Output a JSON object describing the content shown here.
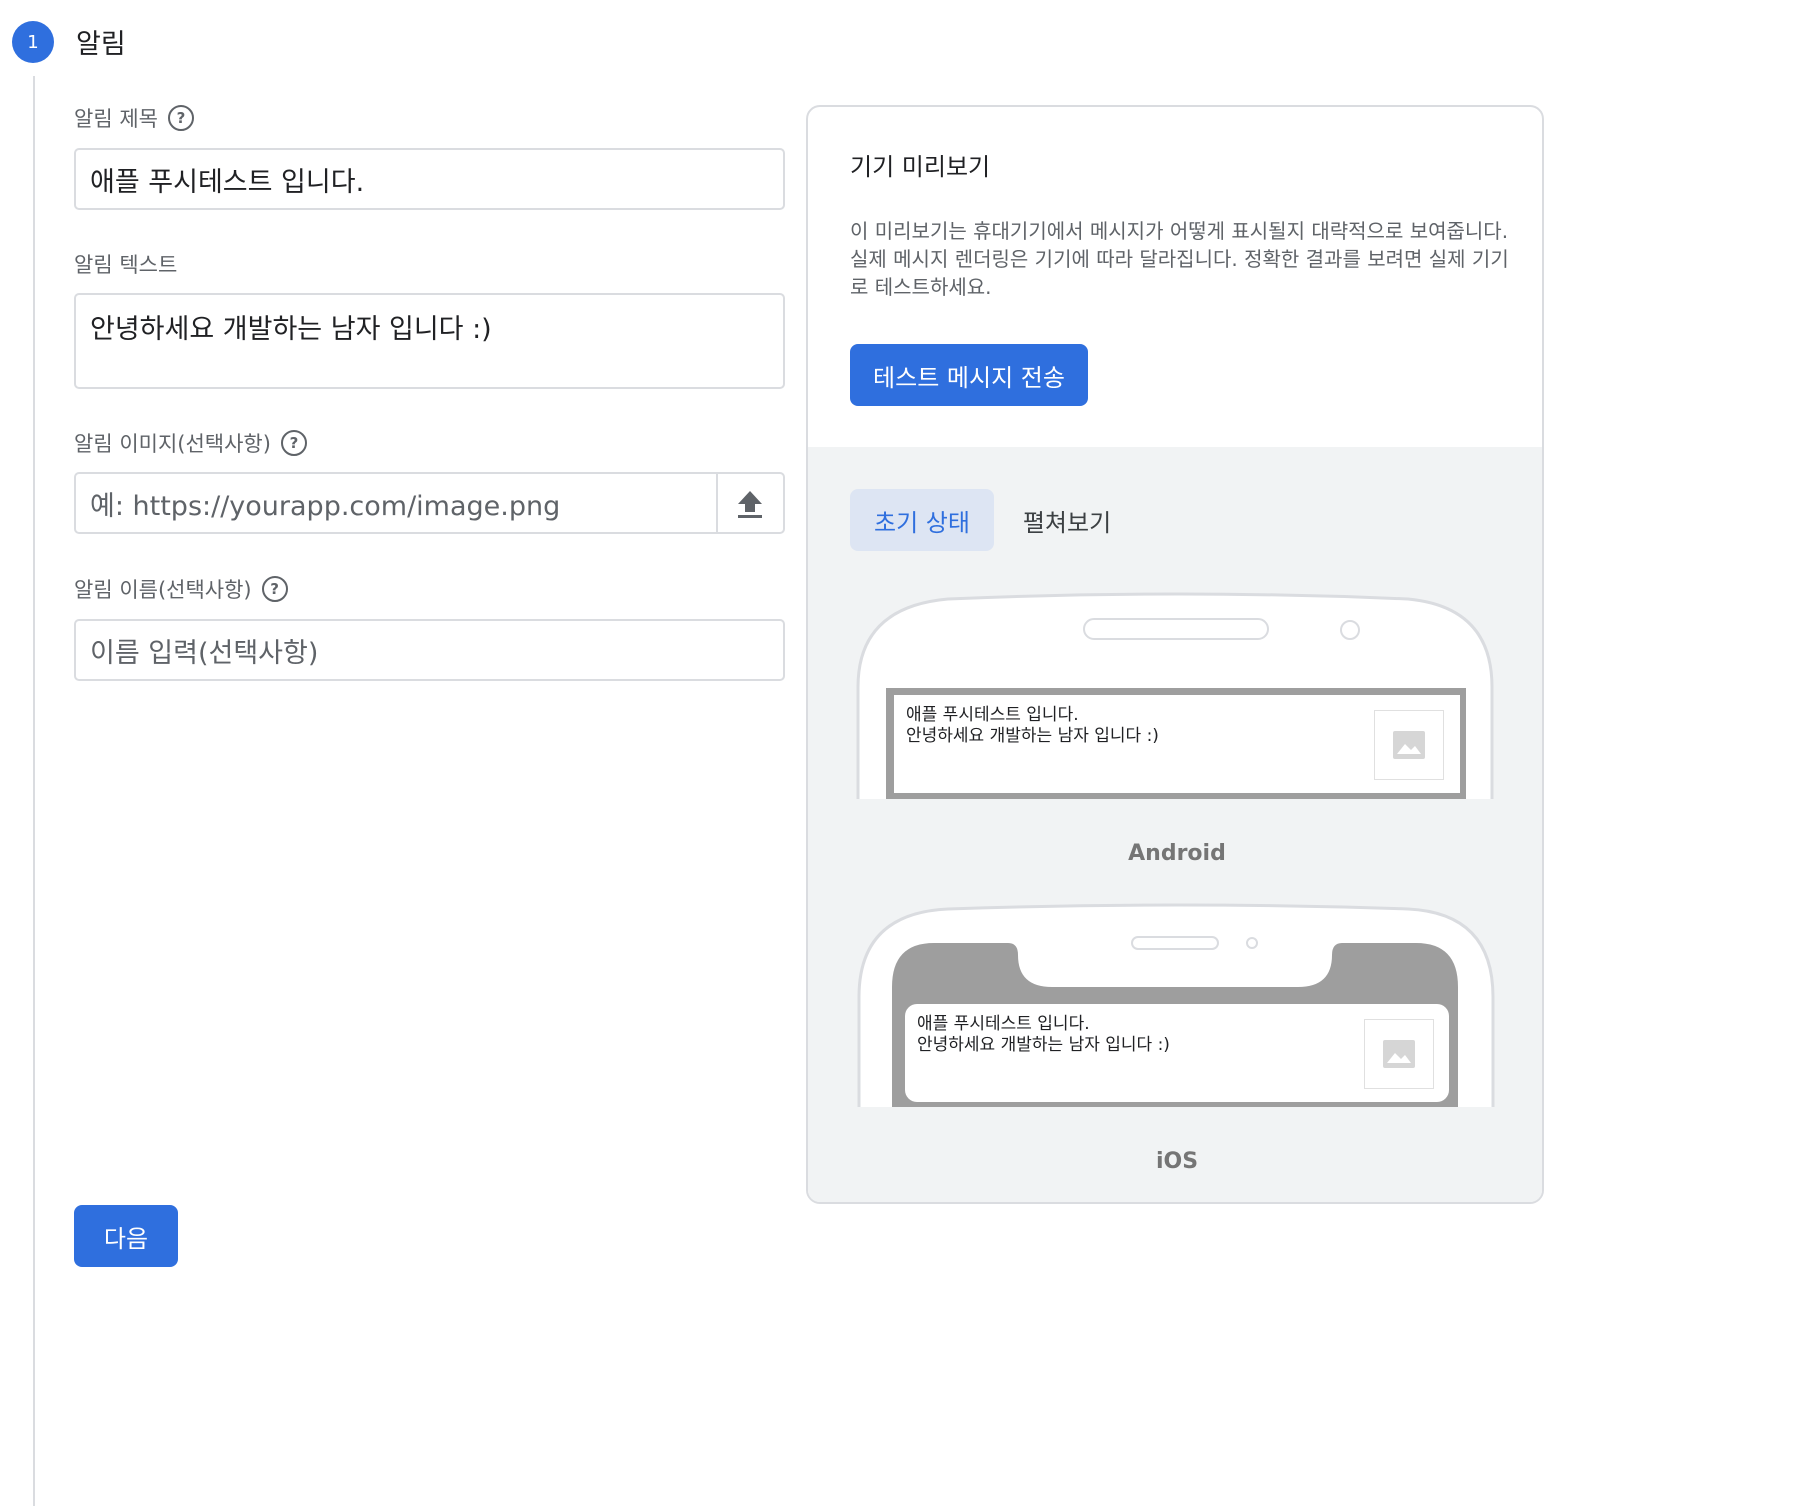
{
  "step": {
    "number": "1",
    "title": "알림"
  },
  "form": {
    "title_label": "알림 제목",
    "title_value": "애플 푸시테스트 입니다.",
    "text_label": "알림 텍스트",
    "text_value": "안녕하세요 개발하는 남자 입니다 :)",
    "image_label": "알림 이미지(선택사항)",
    "image_placeholder": "예: https://yourapp.com/image.png",
    "name_label": "알림 이름(선택사항)",
    "name_placeholder": "이름 입력(선택사항)",
    "help_glyph": "?",
    "next_label": "다음"
  },
  "preview": {
    "title": "기기 미리보기",
    "description": "이 미리보기는 휴대기기에서 메시지가 어떻게 표시될지 대략적으로 보여줍니다. 실제 메시지 렌더링은 기기에 따라 달라집니다. 정확한 결과를 보려면 실제 기기로 테스트하세요.",
    "send_button": "테스트 메시지 전송",
    "tabs": [
      {
        "label": "초기 상태",
        "active": true
      },
      {
        "label": "펼쳐보기",
        "active": false
      }
    ],
    "android": {
      "label": "Android",
      "title": "애플 푸시테스트 입니다.",
      "body": "안녕하세요 개발하는 남자 입니다 :)"
    },
    "ios": {
      "label": "iOS",
      "title": "애플 푸시테스트 입니다.",
      "body": "안녕하세요 개발하는 남자 입니다 :)"
    }
  },
  "colors": {
    "accent": "#2f6fde",
    "tab_active_bg": "#dde5f3",
    "panel_bg": "#f1f3f4"
  },
  "icons": [
    "help-icon",
    "upload-icon",
    "image-placeholder-icon"
  ]
}
